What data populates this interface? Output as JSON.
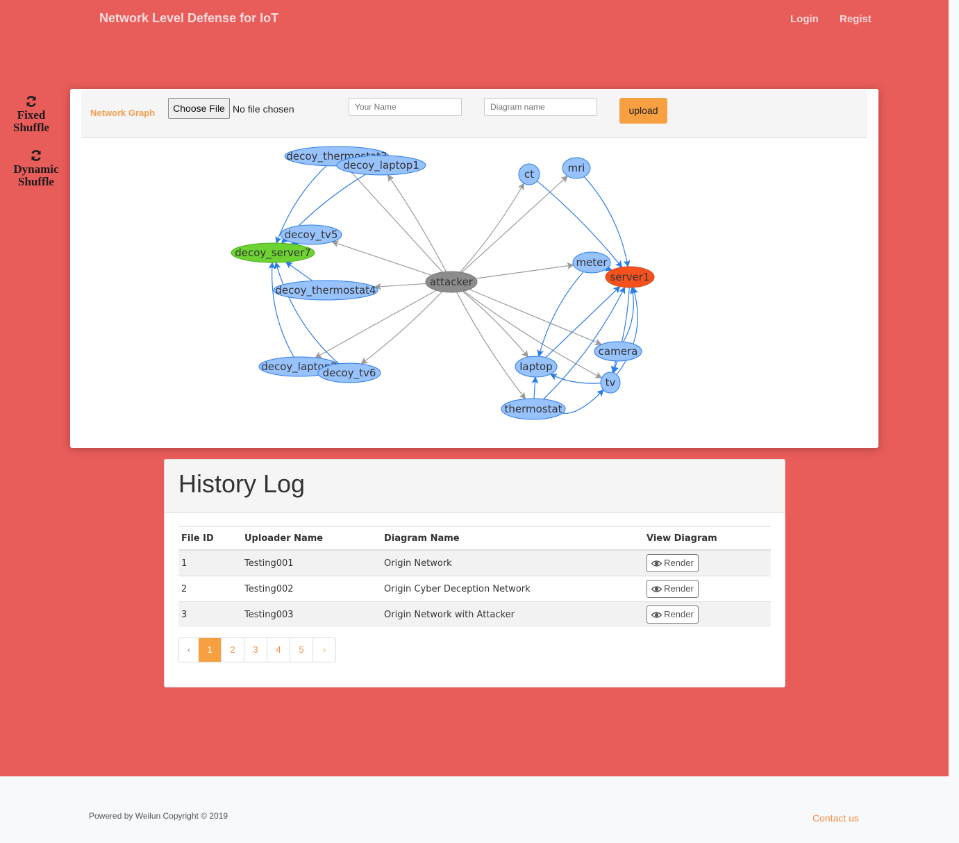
{
  "app": {
    "brand": "Network Level Defense for IoT",
    "nav": {
      "login": "Login",
      "register": "Regist"
    }
  },
  "sidebar": {
    "fixed": {
      "line1": "Fixed",
      "line2": "Shuffle",
      "icon": "refresh-icon"
    },
    "dynamic": {
      "line1": "Dynamic",
      "line2": "Shuffle",
      "icon": "refresh-icon"
    }
  },
  "toolbar": {
    "label": "Network Graph",
    "choose_file": "Choose File",
    "file_status": "No file chosen",
    "name_placeholder": "Your Name",
    "diagram_placeholder": "Diagram name",
    "upload": "upload"
  },
  "graph": {
    "nodes": [
      {
        "id": "decoy_thermostat3",
        "label": "decoy_thermostat3",
        "kind": "decoy"
      },
      {
        "id": "decoy_laptop1",
        "label": "decoy_laptop1",
        "kind": "decoy"
      },
      {
        "id": "decoy_tv5",
        "label": "decoy_tv5",
        "kind": "decoy"
      },
      {
        "id": "decoy_server7",
        "label": "decoy_server7",
        "kind": "decoy-server"
      },
      {
        "id": "decoy_thermostat4",
        "label": "decoy_thermostat4",
        "kind": "decoy"
      },
      {
        "id": "decoy_laptop2",
        "label": "decoy_laptop2",
        "kind": "decoy"
      },
      {
        "id": "decoy_tv6",
        "label": "decoy_tv6",
        "kind": "decoy"
      },
      {
        "id": "attacker",
        "label": "attacker",
        "kind": "attacker"
      },
      {
        "id": "ct",
        "label": "ct",
        "kind": "device"
      },
      {
        "id": "mri",
        "label": "mri",
        "kind": "device"
      },
      {
        "id": "meter",
        "label": "meter",
        "kind": "device"
      },
      {
        "id": "server1",
        "label": "server1",
        "kind": "server"
      },
      {
        "id": "camera",
        "label": "camera",
        "kind": "device"
      },
      {
        "id": "laptop",
        "label": "laptop",
        "kind": "device"
      },
      {
        "id": "tv",
        "label": "tv",
        "kind": "device"
      },
      {
        "id": "thermostat",
        "label": "thermostat",
        "kind": "device"
      }
    ],
    "colors": {
      "device": "#97c2fc",
      "decoy": "#97c2fc",
      "decoy-server": "#6cd332",
      "server": "#f4511e",
      "attacker": "#8c8c8c",
      "attack_edge": "#9a9a9a",
      "link_edge": "#2b7ce9"
    }
  },
  "history": {
    "title": "History Log",
    "columns": [
      "File ID",
      "Uploader Name",
      "Diagram Name",
      "View Diagram"
    ],
    "rows": [
      {
        "id": "1",
        "uploader": "Testing001",
        "diagram": "Origin Network",
        "action": "Render"
      },
      {
        "id": "2",
        "uploader": "Testing002",
        "diagram": "Origin Cyber Deception Network",
        "action": "Render"
      },
      {
        "id": "3",
        "uploader": "Testing003",
        "diagram": "Origin Network with Attacker",
        "action": "Render"
      }
    ],
    "pagination": {
      "prev": "‹",
      "pages": [
        "1",
        "2",
        "3",
        "4",
        "5"
      ],
      "next": "›",
      "active": "1"
    }
  },
  "footer": {
    "copyright": "Powered by Weilun Copyright © 2019",
    "contact": "Contact us"
  }
}
